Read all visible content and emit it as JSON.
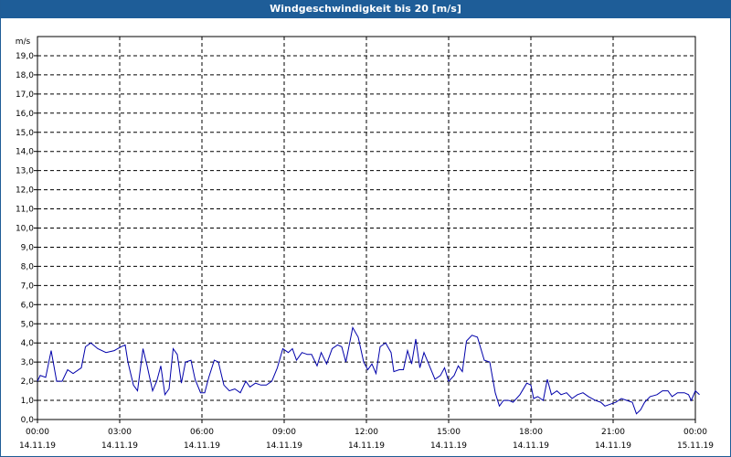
{
  "window": {
    "title": "Windgeschwindigkeit bis 20 [m/s]"
  },
  "colors": {
    "titlebar": "#1e5d98",
    "series": "#0000aa",
    "grid": "#000000"
  },
  "chart_data": {
    "type": "line",
    "title": "Windgeschwindigkeit bis 20 [m/s]",
    "ylabel": "m/s",
    "xlabel": "",
    "ylim": [
      0,
      20
    ],
    "xlim_hours": [
      0,
      24
    ],
    "grid": true,
    "y_ticks": [
      "0,0",
      "1,0",
      "2,0",
      "3,0",
      "4,0",
      "5,0",
      "6,0",
      "7,0",
      "8,0",
      "9,0",
      "10,0",
      "11,0",
      "12,0",
      "13,0",
      "14,0",
      "15,0",
      "16,0",
      "17,0",
      "18,0",
      "19,0"
    ],
    "x_ticks": [
      {
        "hour": 0,
        "time": "00:00",
        "date": "14.11.19"
      },
      {
        "hour": 3,
        "time": "03:00",
        "date": "14.11.19"
      },
      {
        "hour": 6,
        "time": "06:00",
        "date": "14.11.19"
      },
      {
        "hour": 9,
        "time": "09:00",
        "date": "14.11.19"
      },
      {
        "hour": 12,
        "time": "12:00",
        "date": "14.11.19"
      },
      {
        "hour": 15,
        "time": "15:00",
        "date": "14.11.19"
      },
      {
        "hour": 18,
        "time": "18:00",
        "date": "14.11.19"
      },
      {
        "hour": 21,
        "time": "21:00",
        "date": "14.11.19"
      },
      {
        "hour": 24,
        "time": "00:00",
        "date": "15.11.19"
      }
    ],
    "series": [
      {
        "points": [
          [
            0.0,
            2.0
          ],
          [
            0.1,
            2.3
          ],
          [
            0.3,
            2.2
          ],
          [
            0.5,
            3.6
          ],
          [
            0.7,
            2.0
          ],
          [
            0.9,
            2.0
          ],
          [
            1.1,
            2.6
          ],
          [
            1.3,
            2.4
          ],
          [
            1.6,
            2.7
          ],
          [
            1.75,
            3.8
          ],
          [
            1.95,
            4.0
          ],
          [
            2.2,
            3.7
          ],
          [
            2.5,
            3.5
          ],
          [
            2.8,
            3.6
          ],
          [
            3.05,
            3.8
          ],
          [
            3.2,
            3.9
          ],
          [
            3.3,
            3.0
          ],
          [
            3.5,
            1.8
          ],
          [
            3.65,
            1.5
          ],
          [
            3.85,
            3.7
          ],
          [
            4.0,
            2.8
          ],
          [
            4.2,
            1.5
          ],
          [
            4.35,
            2.0
          ],
          [
            4.5,
            2.8
          ],
          [
            4.65,
            1.3
          ],
          [
            4.8,
            1.6
          ],
          [
            4.95,
            3.7
          ],
          [
            5.1,
            3.4
          ],
          [
            5.25,
            1.9
          ],
          [
            5.4,
            3.0
          ],
          [
            5.6,
            3.1
          ],
          [
            5.75,
            2.1
          ],
          [
            5.95,
            1.4
          ],
          [
            6.1,
            1.4
          ],
          [
            6.25,
            2.2
          ],
          [
            6.45,
            3.1
          ],
          [
            6.6,
            3.0
          ],
          [
            6.8,
            1.8
          ],
          [
            7.0,
            1.5
          ],
          [
            7.2,
            1.6
          ],
          [
            7.4,
            1.4
          ],
          [
            7.6,
            2.0
          ],
          [
            7.75,
            1.7
          ],
          [
            7.95,
            1.9
          ],
          [
            8.15,
            1.8
          ],
          [
            8.35,
            1.8
          ],
          [
            8.55,
            2.0
          ],
          [
            8.75,
            2.7
          ],
          [
            8.95,
            3.7
          ],
          [
            9.15,
            3.5
          ],
          [
            9.3,
            3.7
          ],
          [
            9.45,
            3.1
          ],
          [
            9.65,
            3.5
          ],
          [
            9.85,
            3.4
          ],
          [
            10.0,
            3.4
          ],
          [
            10.2,
            2.8
          ],
          [
            10.35,
            3.5
          ],
          [
            10.55,
            2.9
          ],
          [
            10.75,
            3.7
          ],
          [
            10.95,
            3.9
          ],
          [
            11.1,
            3.8
          ],
          [
            11.25,
            3.0
          ],
          [
            11.5,
            4.8
          ],
          [
            11.7,
            4.3
          ],
          [
            11.9,
            3.0
          ],
          [
            12.05,
            2.6
          ],
          [
            12.2,
            2.9
          ],
          [
            12.35,
            2.4
          ],
          [
            12.5,
            3.8
          ],
          [
            12.7,
            4.0
          ],
          [
            12.9,
            3.5
          ],
          [
            13.0,
            2.5
          ],
          [
            13.2,
            2.6
          ],
          [
            13.35,
            2.6
          ],
          [
            13.5,
            3.6
          ],
          [
            13.65,
            2.9
          ],
          [
            13.8,
            4.2
          ],
          [
            13.95,
            2.7
          ],
          [
            14.1,
            3.5
          ],
          [
            14.3,
            2.8
          ],
          [
            14.5,
            2.1
          ],
          [
            14.7,
            2.3
          ],
          [
            14.85,
            2.7
          ],
          [
            15.0,
            2.0
          ],
          [
            15.2,
            2.3
          ],
          [
            15.35,
            2.8
          ],
          [
            15.5,
            2.5
          ],
          [
            15.65,
            4.1
          ],
          [
            15.85,
            4.4
          ],
          [
            16.05,
            4.3
          ],
          [
            16.3,
            3.1
          ],
          [
            16.5,
            3.0
          ],
          [
            16.7,
            1.4
          ],
          [
            16.85,
            0.7
          ],
          [
            17.0,
            1.0
          ],
          [
            17.2,
            1.0
          ],
          [
            17.35,
            0.9
          ],
          [
            17.6,
            1.3
          ],
          [
            17.85,
            1.9
          ],
          [
            18.0,
            1.8
          ],
          [
            18.1,
            1.1
          ],
          [
            18.25,
            1.2
          ],
          [
            18.45,
            1.0
          ],
          [
            18.6,
            2.1
          ],
          [
            18.75,
            1.3
          ],
          [
            18.95,
            1.5
          ],
          [
            19.1,
            1.3
          ],
          [
            19.3,
            1.4
          ],
          [
            19.5,
            1.1
          ],
          [
            19.7,
            1.3
          ],
          [
            19.9,
            1.4
          ],
          [
            20.1,
            1.2
          ],
          [
            20.35,
            1.0
          ],
          [
            20.55,
            0.9
          ],
          [
            20.7,
            0.7
          ],
          [
            20.9,
            0.8
          ],
          [
            21.1,
            0.9
          ],
          [
            21.3,
            1.1
          ],
          [
            21.5,
            1.0
          ],
          [
            21.7,
            0.9
          ],
          [
            21.85,
            0.3
          ],
          [
            22.0,
            0.5
          ],
          [
            22.15,
            0.9
          ],
          [
            22.35,
            1.2
          ],
          [
            22.6,
            1.3
          ],
          [
            22.8,
            1.5
          ],
          [
            23.0,
            1.5
          ],
          [
            23.15,
            1.2
          ],
          [
            23.35,
            1.4
          ],
          [
            23.6,
            1.4
          ],
          [
            23.75,
            1.3
          ],
          [
            23.85,
            1.0
          ],
          [
            24.0,
            1.5
          ],
          [
            24.15,
            1.3
          ]
        ]
      }
    ]
  }
}
